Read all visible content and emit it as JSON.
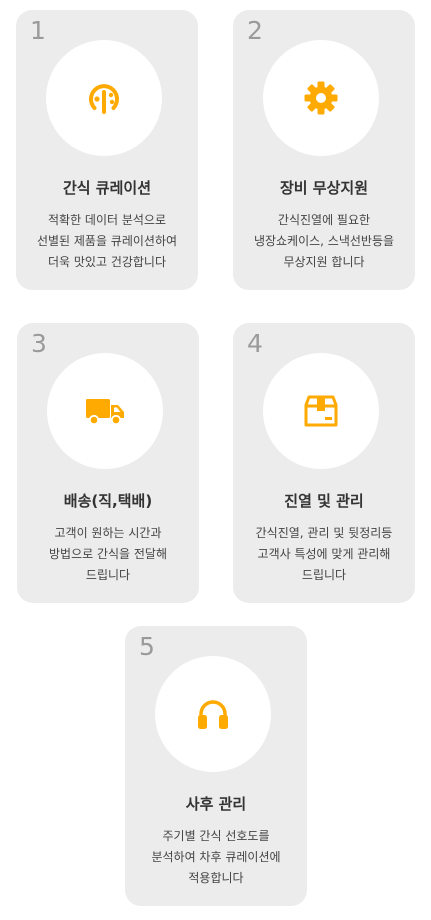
{
  "accent_color": "#ffaa00",
  "cards": [
    {
      "number": "1",
      "icon": "curation-icon",
      "title": "간식 큐레이션",
      "description": "적확한 데이터 분석으로\n선별된 제품을  큐레이션하여\n더욱 맛있고 건강합니다"
    },
    {
      "number": "2",
      "icon": "gear-icon",
      "title": "장비 무상지원",
      "description": "간식진열에 필요한\n냉장쇼케이스, 스낵선반등을\n무상지원 합니다"
    },
    {
      "number": "3",
      "icon": "delivery-truck-icon",
      "title": "배송(직,택배)",
      "description": "고객이 원하는 시간과\n방법으로 간식을 전달해\n드립니다"
    },
    {
      "number": "4",
      "icon": "box-icon",
      "title": "진열 및 관리",
      "description": "간식진열, 관리 및 뒷정리등\n고객사 특성에 맞게 관리해\n드립니다"
    },
    {
      "number": "5",
      "icon": "headphones-icon",
      "title": "사후 관리",
      "description": "주기별 간식 선호도를\n분석하여 차후 큐레이션에\n적용합니다"
    }
  ]
}
